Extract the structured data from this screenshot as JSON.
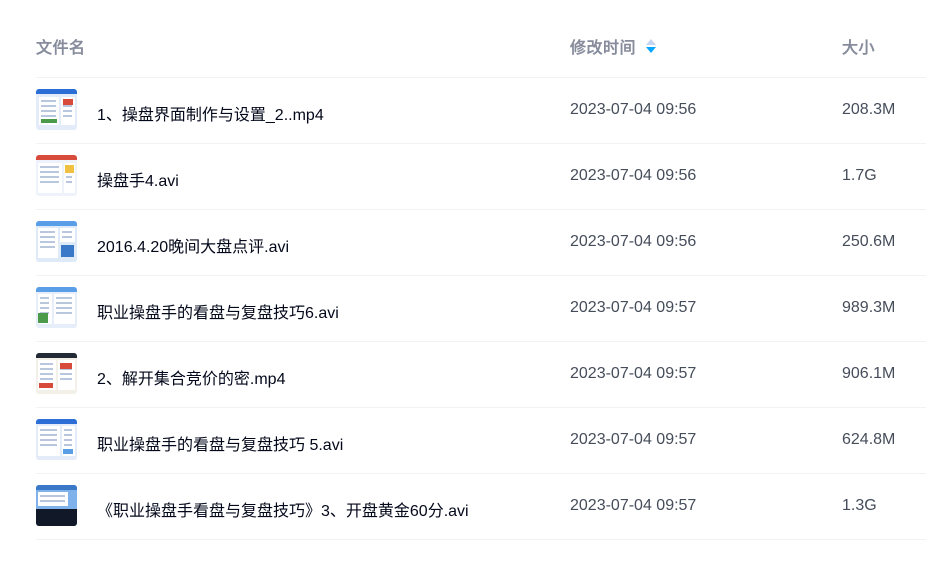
{
  "columns": {
    "name": "文件名",
    "time": "修改时间",
    "size": "大小",
    "sort_icon": "sort-descending-icon",
    "sort_active_color": "#06a7ff"
  },
  "files": [
    {
      "name": "1、操盘界面制作与设置_2..mp4",
      "modified": "2023-07-04 09:56",
      "size": "208.3M",
      "thumbnail": "video-thumbnail-icon"
    },
    {
      "name": "操盘手4.avi",
      "modified": "2023-07-04 09:56",
      "size": "1.7G",
      "thumbnail": "video-thumbnail-icon"
    },
    {
      "name": "2016.4.20晚间大盘点评.avi",
      "modified": "2023-07-04 09:56",
      "size": "250.6M",
      "thumbnail": "video-thumbnail-icon"
    },
    {
      "name": "职业操盘手的看盘与复盘技巧6.avi",
      "modified": "2023-07-04 09:57",
      "size": "989.3M",
      "thumbnail": "video-thumbnail-icon"
    },
    {
      "name": "2、解开集合竞价的密.mp4",
      "modified": "2023-07-04 09:57",
      "size": "906.1M",
      "thumbnail": "video-thumbnail-icon"
    },
    {
      "name": "职业操盘手的看盘与复盘技巧 5.avi",
      "modified": "2023-07-04 09:57",
      "size": "624.8M",
      "thumbnail": "video-thumbnail-icon"
    },
    {
      "name": "《职业操盘手看盘与复盘技巧》3、开盘黄金60分.avi",
      "modified": "2023-07-04 09:57",
      "size": "1.3G",
      "thumbnail": "video-thumbnail-icon"
    }
  ]
}
